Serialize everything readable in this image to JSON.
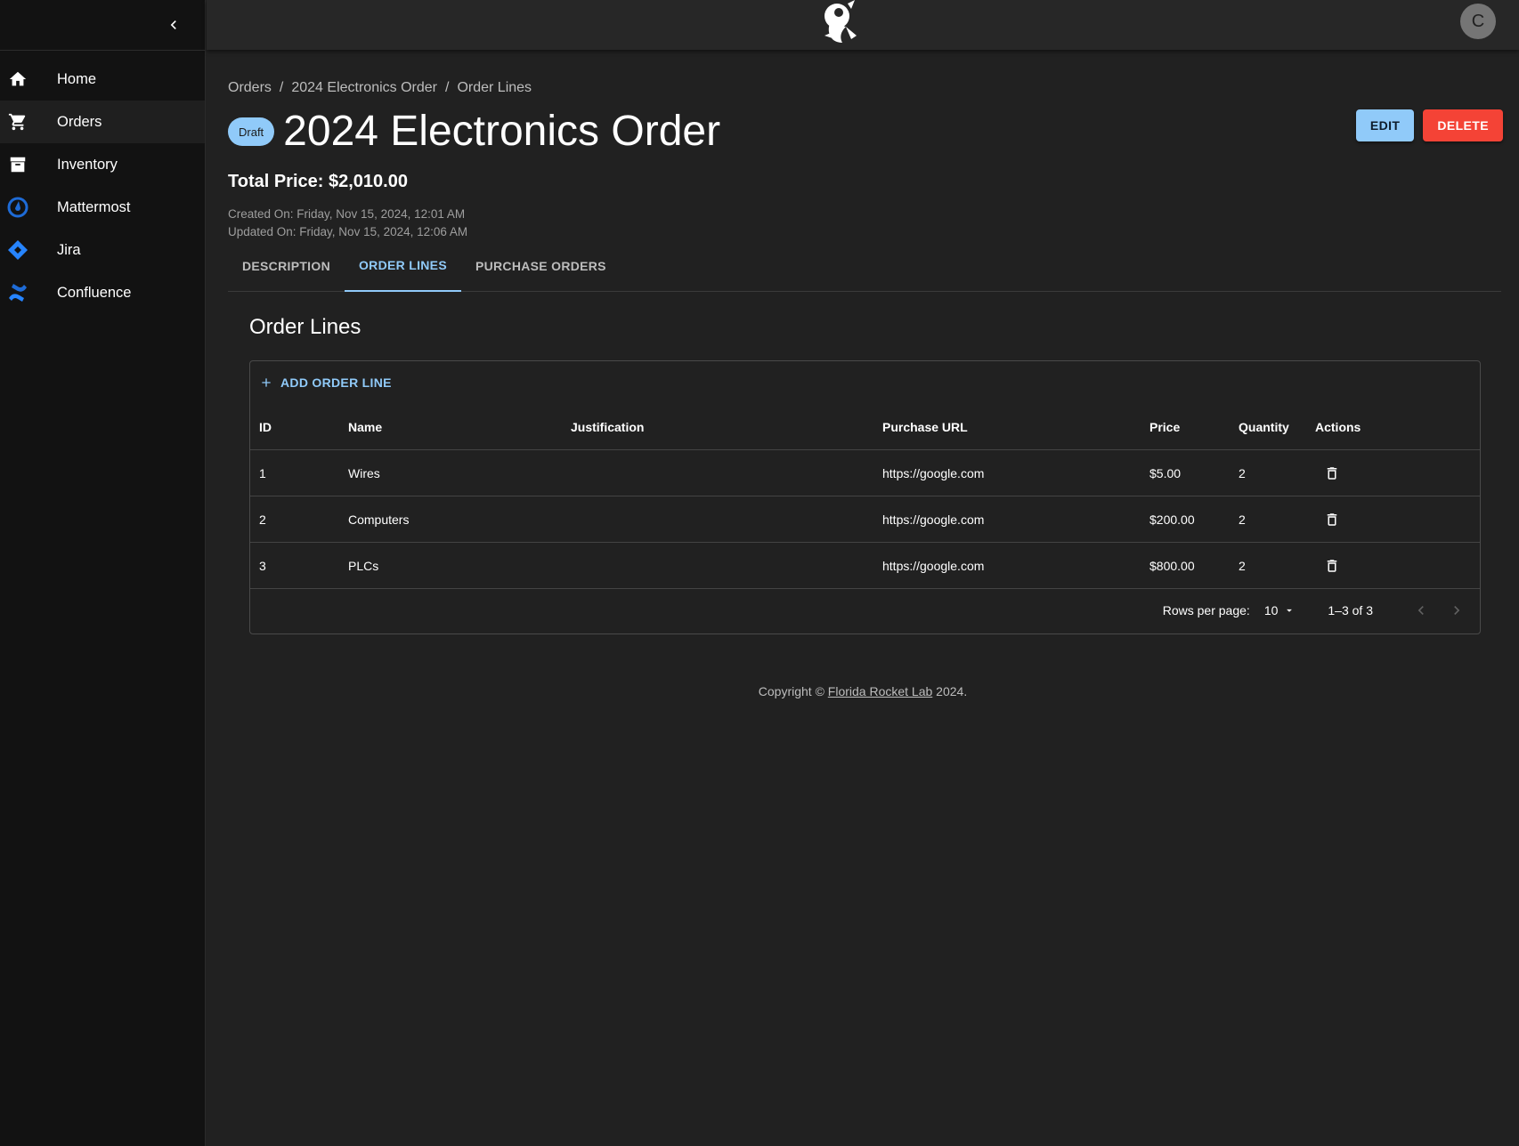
{
  "nav": {
    "items": [
      {
        "label": "Home",
        "icon": "home-icon"
      },
      {
        "label": "Orders",
        "icon": "cart-icon"
      },
      {
        "label": "Inventory",
        "icon": "archive-icon"
      },
      {
        "label": "Mattermost",
        "icon": "mattermost-icon"
      },
      {
        "label": "Jira",
        "icon": "jira-icon"
      },
      {
        "label": "Confluence",
        "icon": "confluence-icon"
      }
    ]
  },
  "topbar": {
    "avatar_initial": "C",
    "logo": "rocket-lab-logo"
  },
  "breadcrumb": [
    "Orders",
    "2024 Electronics Order",
    "Order Lines"
  ],
  "order": {
    "status": "Draft",
    "title": "2024 Electronics Order",
    "total": "Total Price: $2,010.00",
    "created": "Created On: Friday, Nov 15, 2024, 12:01 AM",
    "updated": "Updated On: Friday, Nov 15, 2024, 12:06 AM"
  },
  "buttons": {
    "edit": "EDIT",
    "delete": "DELETE"
  },
  "tabs": [
    "DESCRIPTION",
    "ORDER LINES",
    "PURCHASE ORDERS"
  ],
  "section_title": "Order Lines",
  "grid": {
    "add_label": "ADD ORDER LINE",
    "columns": [
      "ID",
      "Name",
      "Justification",
      "Purchase URL",
      "Price",
      "Quantity",
      "Actions"
    ],
    "rows": [
      {
        "id": "1",
        "name": "Wires",
        "justification": "",
        "url": "https://google.com",
        "price": "$5.00",
        "qty": "2"
      },
      {
        "id": "2",
        "name": "Computers",
        "justification": "",
        "url": "https://google.com",
        "price": "$200.00",
        "qty": "2"
      },
      {
        "id": "3",
        "name": "PLCs",
        "justification": "",
        "url": "https://google.com",
        "price": "$800.00",
        "qty": "2"
      }
    ],
    "rows_per_page_label": "Rows per page:",
    "rows_per_page": "10",
    "range": "1–3 of 3"
  },
  "footer": {
    "prefix": "Copyright © ",
    "link": "Florida Rocket Lab",
    "suffix": " 2024."
  },
  "colors": {
    "accent": "#90caf9",
    "danger": "#f44336",
    "background": "#212121",
    "sidebar": "#121212"
  }
}
